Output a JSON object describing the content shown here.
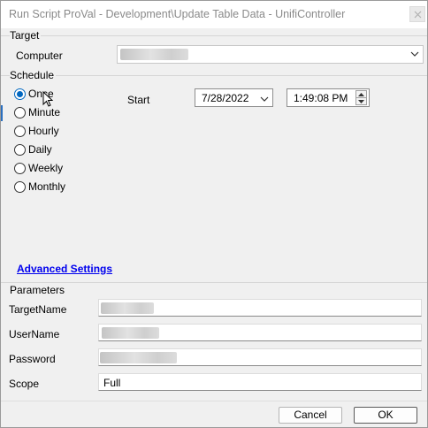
{
  "window": {
    "title": "Run Script ProVal - Development\\Update Table Data - UnifiController"
  },
  "target": {
    "group_label": "Target",
    "computer_label": "Computer"
  },
  "schedule": {
    "group_label": "Schedule",
    "options": [
      "Once",
      "Minute",
      "Hourly",
      "Daily",
      "Weekly",
      "Monthly"
    ],
    "selected": "Once",
    "start_label": "Start",
    "start_date": "7/28/2022",
    "start_time": "1:49:08 PM"
  },
  "advanced_settings_label": "Advanced Settings",
  "parameters": {
    "group_label": "Parameters",
    "fields": [
      {
        "label": "TargetName",
        "value": ""
      },
      {
        "label": "UserName",
        "value": ""
      },
      {
        "label": "Password",
        "value": ""
      },
      {
        "label": "Scope",
        "value": "Full"
      }
    ]
  },
  "buttons": {
    "cancel": "Cancel",
    "ok": "OK"
  },
  "colors": {
    "accent": "#0067c0",
    "link": "#0000ee"
  }
}
